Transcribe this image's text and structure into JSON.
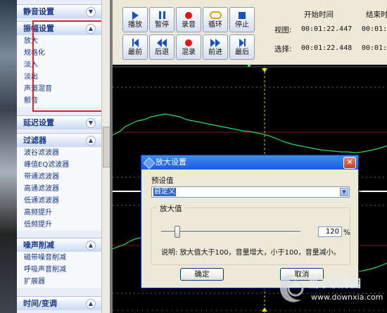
{
  "sidebar": {
    "groups": [
      {
        "title": "静音设置",
        "expanded": false,
        "items": []
      },
      {
        "title": "振幅设置",
        "expanded": true,
        "items": [
          "放大",
          "规格化",
          "淡入",
          "淡出",
          "声道混音",
          "颤音"
        ]
      },
      {
        "title": "延迟设置",
        "expanded": false,
        "items": []
      },
      {
        "title": "过滤器",
        "expanded": true,
        "items": [
          "波谷滤波器",
          "峰值EQ滤波器",
          "带通滤波器",
          "高通滤波器",
          "低通滤波器",
          "高频提升",
          "低频提升"
        ]
      },
      {
        "title": "噪声削减",
        "expanded": true,
        "items": [
          "磁带噪音削减",
          "呼吸声音削减",
          "扩展器"
        ]
      },
      {
        "title": "时间/变调",
        "expanded": true,
        "items": []
      }
    ]
  },
  "toolbar": {
    "row1": [
      {
        "label": "播放",
        "icon": "play-icon"
      },
      {
        "label": "暂停",
        "icon": "pause-icon"
      },
      {
        "label": "录音",
        "icon": "record-icon"
      },
      {
        "label": "循环",
        "icon": "loop-icon"
      },
      {
        "label": "停止",
        "icon": "stop-icon"
      }
    ],
    "row2": [
      {
        "label": "最前",
        "icon": "go-start-icon"
      },
      {
        "label": "后退",
        "icon": "rewind-icon"
      },
      {
        "label": "混录",
        "icon": "mix-record-icon"
      },
      {
        "label": "前进",
        "icon": "forward-icon"
      },
      {
        "label": "最后",
        "icon": "go-end-icon"
      }
    ]
  },
  "times": {
    "start_header": "开始时间",
    "end_header": "结束时",
    "view_label": "视图:",
    "view_start": "00:01:22.447",
    "view_end": "00:01:",
    "select_label": "选择:",
    "select_start": "00:01:22.448",
    "select_end": "00:01:"
  },
  "dialog": {
    "title": "放大设置",
    "preset_label": "预设值",
    "preset_value": "自定义",
    "group_label": "放大值",
    "amplify_value": "120",
    "unit": "%",
    "slider_level": 0.12,
    "note": "说明: 放大值大于100，音量增大，小于100，音量减小。",
    "ok_label": "确定",
    "cancel_label": "取消"
  },
  "watermark": {
    "line1": "当下软件园",
    "line2": "www.downxia.com"
  },
  "colors": {
    "waveform": "#2dd86a",
    "waveform_bg": "#000000",
    "selection_line": "#d8c400",
    "highlight_box": "#e0202a",
    "title_bar": "#1c5ae0"
  }
}
